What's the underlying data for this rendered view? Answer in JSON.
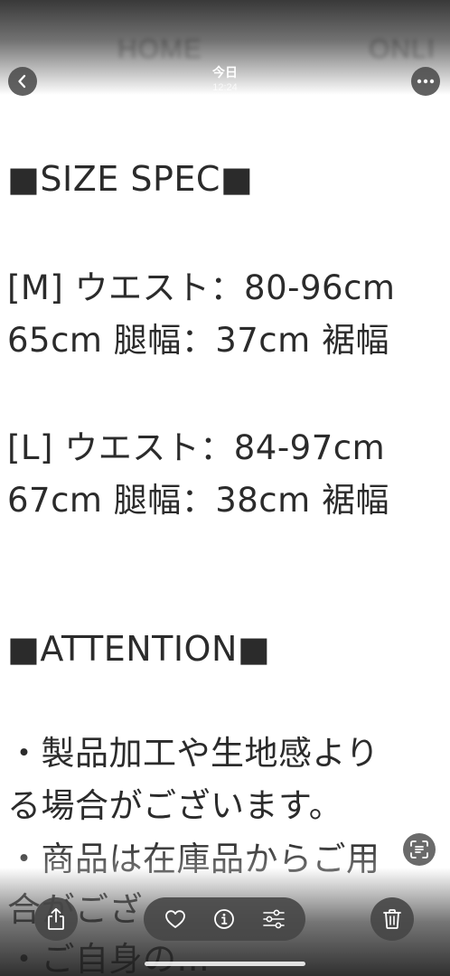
{
  "header": {
    "title": "今日",
    "time": "12:24"
  },
  "photo": {
    "nav": {
      "home": "HOME",
      "online": "ONLI"
    },
    "lines": [
      "■SIZE SPEC■",
      "[M] ウエスト：80-96cm",
      "65cm 腿幅：37cm 裾幅",
      "[L] ウエスト：84-97cm",
      "67cm 腿幅：38cm 裾幅",
      "■ATTENTION■",
      "・製品加工や生地感より",
      "る場合がございます。",
      "・商品は在庫品からご用",
      "合がござ",
      "・ご自身の..."
    ]
  },
  "toolbar": {
    "share": "share-icon",
    "favorite": "heart-icon",
    "info": "info-icon",
    "adjust": "sliders-icon",
    "delete": "trash-icon",
    "live_text": "live-text-icon"
  },
  "colors": {
    "control_bg": "#464646",
    "icon": "#ffffff",
    "text": "#2b2b2b"
  }
}
